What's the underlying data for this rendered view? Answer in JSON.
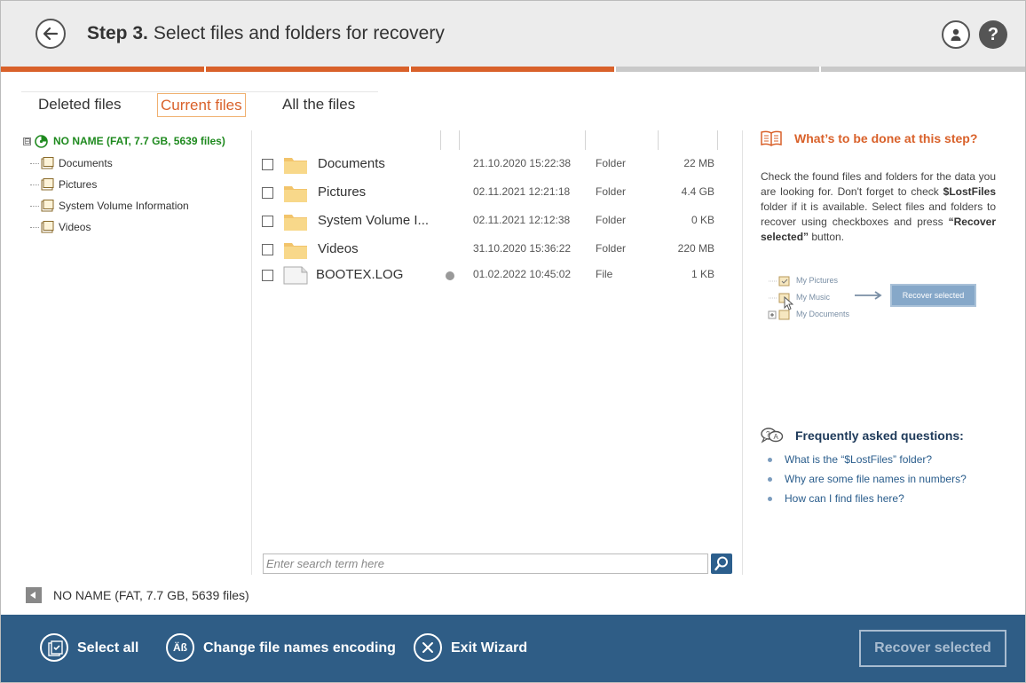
{
  "header": {
    "step_label": "Step 3.",
    "title": "Select files and folders for recovery",
    "back_icon": "arrow-left-icon",
    "user_icon": "user-icon",
    "help_label": "?"
  },
  "progress": {
    "completed_fraction": 0.6,
    "segments": 5
  },
  "tabs": [
    {
      "label": "Deleted files",
      "active": false
    },
    {
      "label": "Current files",
      "active": true
    },
    {
      "label": "All the files",
      "active": false
    }
  ],
  "tree": {
    "root": {
      "label": "NO NAME (FAT, 7.7 GB, 5639 files)",
      "expander": "⊟"
    },
    "items": [
      {
        "label": "Documents"
      },
      {
        "label": "Pictures"
      },
      {
        "label": "System Volume Information"
      },
      {
        "label": "Videos"
      }
    ]
  },
  "files": [
    {
      "name": "Documents",
      "date": "21.10.2020 15:22:38",
      "type": "Folder",
      "size": "22 MB",
      "icon": "folder-icon"
    },
    {
      "name": "Pictures",
      "date": "02.11.2021 12:21:18",
      "type": "Folder",
      "size": "4.4 GB",
      "icon": "folder-icon"
    },
    {
      "name": "System Volume I...",
      "date": "02.11.2021 12:12:38",
      "type": "Folder",
      "size": "0 KB",
      "icon": "folder-icon"
    },
    {
      "name": "Videos",
      "date": "31.10.2020 15:36:22",
      "type": "Folder",
      "size": "220 MB",
      "icon": "folder-icon"
    },
    {
      "name": "BOOTEX.LOG",
      "date": "01.02.2022 10:45:02",
      "type": "File",
      "size": "1 KB",
      "icon": "file-icon"
    }
  ],
  "search": {
    "placeholder": "Enter search term here",
    "value": ""
  },
  "help": {
    "heading": "What’s to be done at this step?",
    "text_1": "Check the found files and folders for the data you are looking for. Don't forget to check ",
    "text_bold_1": "$LostFiles",
    "text_2": " folder if it is available. Select files and folders to recover using checkboxes and press ",
    "text_bold_2": "“Recover selected”",
    "text_3": " button.",
    "illustration": {
      "items": [
        "My Pictures",
        "My Music",
        "My Documents"
      ],
      "button": "Recover selected"
    }
  },
  "faq": {
    "heading": "Frequently asked questions:",
    "items": [
      "What is the “$LostFiles” folder?",
      "Why are some file names in numbers?",
      "How can I find files here?"
    ]
  },
  "status": {
    "text": "NO NAME (FAT, 7.7 GB, 5639 files)"
  },
  "footer": {
    "select_all": "Select all",
    "change_encoding": "Change file names encoding",
    "encoding_icon_text": "Äß",
    "exit_wizard": "Exit Wizard",
    "recover_selected": "Recover selected"
  },
  "colors": {
    "accent": "#d9612a",
    "footer_bg": "#2f5d86",
    "tree_root": "#1f8a1f",
    "link": "#2a5d8c"
  }
}
